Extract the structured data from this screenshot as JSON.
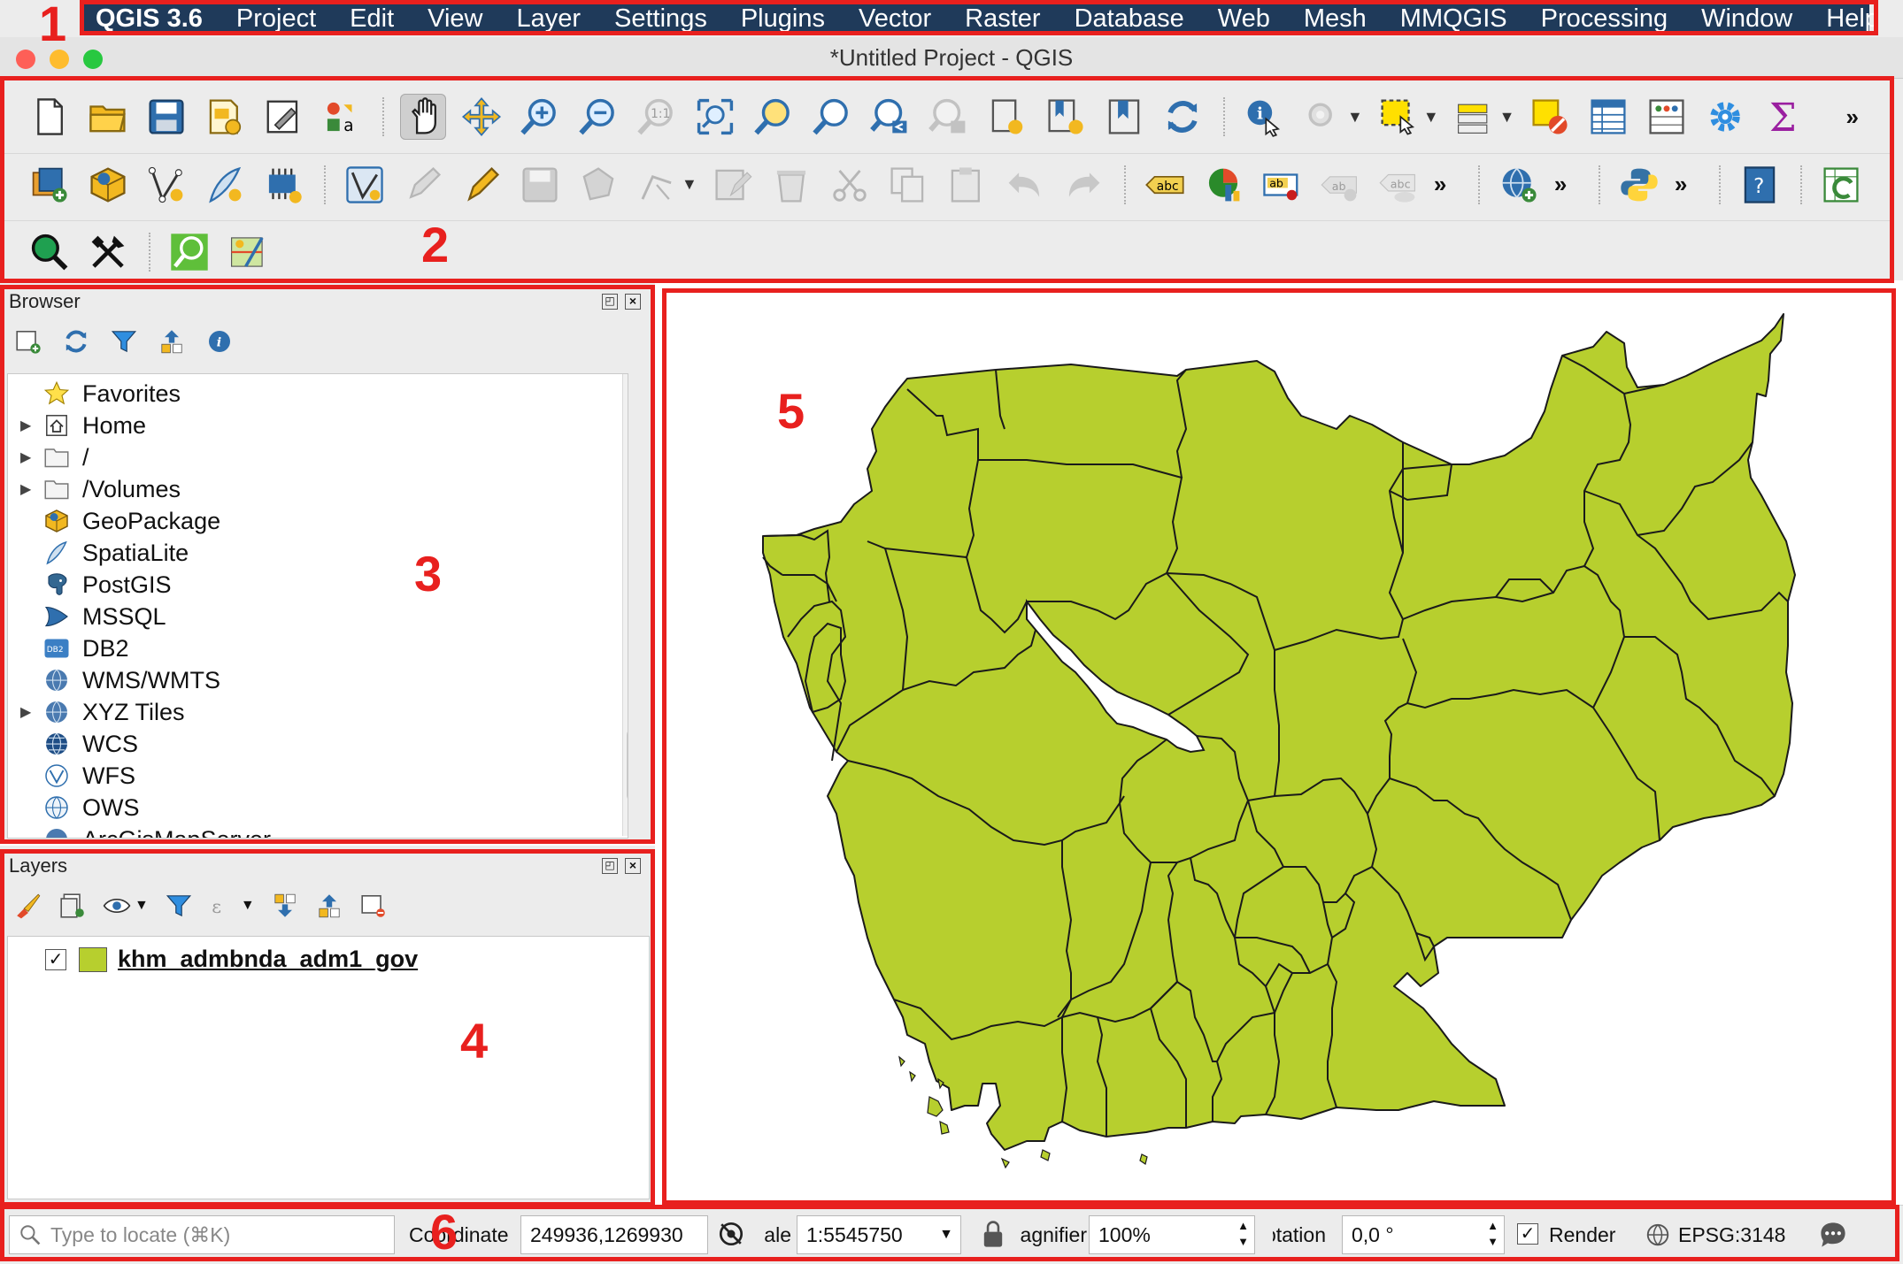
{
  "menubar": {
    "app_name": "QGIS 3.6",
    "items": [
      "Project",
      "Edit",
      "View",
      "Layer",
      "Settings",
      "Plugins",
      "Vector",
      "Raster",
      "Database",
      "Web",
      "Mesh",
      "MMQGIS",
      "Processing",
      "Window",
      "Help"
    ]
  },
  "window": {
    "title": "*Untitled Project - QGIS"
  },
  "annotations": [
    "1",
    "2",
    "3",
    "4",
    "5",
    "6"
  ],
  "browser": {
    "title": "Browser",
    "items": [
      {
        "label": "Favorites",
        "icon": "star-icon",
        "expandable": false
      },
      {
        "label": "Home",
        "icon": "home-icon",
        "expandable": true
      },
      {
        "label": "/",
        "icon": "folder-icon",
        "expandable": true
      },
      {
        "label": "/Volumes",
        "icon": "folder-icon",
        "expandable": true
      },
      {
        "label": "GeoPackage",
        "icon": "geopackage-icon",
        "expandable": false
      },
      {
        "label": "SpatiaLite",
        "icon": "spatialite-icon",
        "expandable": false
      },
      {
        "label": "PostGIS",
        "icon": "postgis-icon",
        "expandable": false
      },
      {
        "label": "MSSQL",
        "icon": "mssql-icon",
        "expandable": false
      },
      {
        "label": "DB2",
        "icon": "db2-icon",
        "expandable": false
      },
      {
        "label": "WMS/WMTS",
        "icon": "wms-icon",
        "expandable": false
      },
      {
        "label": "XYZ Tiles",
        "icon": "xyz-icon",
        "expandable": true
      },
      {
        "label": "WCS",
        "icon": "wcs-icon",
        "expandable": false
      },
      {
        "label": "WFS",
        "icon": "wfs-icon",
        "expandable": false
      },
      {
        "label": "OWS",
        "icon": "ows-icon",
        "expandable": false
      },
      {
        "label": "ArcGisMapServer",
        "icon": "arcgis-icon",
        "expandable": false
      }
    ]
  },
  "layers": {
    "title": "Layers",
    "items": [
      {
        "label": "khm_admbnda_adm1_gov",
        "checked": true,
        "fill": "#b7cf2e"
      }
    ]
  },
  "map": {
    "fill_color": "#b7cf2e",
    "stroke_color": "#1a1a1a",
    "water_color": "#ffffff"
  },
  "statusbar": {
    "locate_placeholder": "Type to locate (⌘K)",
    "coordinate_label": "Coordinate",
    "coordinate_value": "249936,1269930",
    "scale_label": "Scale",
    "scale_value": "1:5545750",
    "magnifier_label": "Magnifier",
    "magnifier_value": "100%",
    "rotation_label": "Rotation",
    "rotation_value": "0,0 °",
    "render_label": "Render",
    "render_checked": true,
    "crs": "EPSG:3148"
  },
  "colors": {
    "annotation_red": "#e8201e",
    "menubar_bg": "#1f3a5a"
  }
}
